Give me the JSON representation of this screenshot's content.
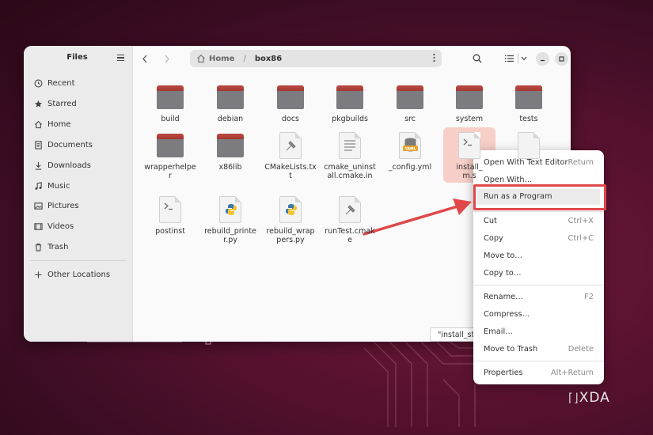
{
  "sidebar": {
    "title": "Files",
    "items": [
      {
        "label": "Recent",
        "icon": "clock-icon"
      },
      {
        "label": "Starred",
        "icon": "star-icon"
      },
      {
        "label": "Home",
        "icon": "home-icon"
      },
      {
        "label": "Documents",
        "icon": "document-icon"
      },
      {
        "label": "Downloads",
        "icon": "download-icon"
      },
      {
        "label": "Music",
        "icon": "music-icon"
      },
      {
        "label": "Pictures",
        "icon": "picture-icon"
      },
      {
        "label": "Videos",
        "icon": "video-icon"
      },
      {
        "label": "Trash",
        "icon": "trash-icon"
      }
    ],
    "other_locations": "Other Locations"
  },
  "path": {
    "home": "Home",
    "current": "box86"
  },
  "files": [
    {
      "label": "build",
      "type": "folder"
    },
    {
      "label": "debian",
      "type": "folder"
    },
    {
      "label": "docs",
      "type": "folder"
    },
    {
      "label": "pkgbuilds",
      "type": "folder"
    },
    {
      "label": "src",
      "type": "folder"
    },
    {
      "label": "system",
      "type": "folder"
    },
    {
      "label": "tests",
      "type": "folder"
    },
    {
      "label": "wrapperhelper",
      "type": "folder"
    },
    {
      "label": "x86lib",
      "type": "folder"
    },
    {
      "label": "CMakeLists.txt",
      "type": "cmake"
    },
    {
      "label": "cmake_uninstall.cmake.in",
      "type": "text"
    },
    {
      "label": "_config.yml",
      "type": "yaml"
    },
    {
      "label": "install_steam.sh",
      "type": "script"
    },
    {
      "label": "postinst",
      "type": "script"
    },
    {
      "label": "rebuild_printer.py",
      "type": "python"
    },
    {
      "label": "rebuild_wrappers.py",
      "type": "python"
    },
    {
      "label": "runTest.cmake",
      "type": "cmake"
    }
  ],
  "selected_label": "install_\nm.s",
  "tooltip": "\"install_steam.sh\"",
  "context_menu": [
    {
      "label": "Open With Text Editor",
      "shortcut": "Return"
    },
    {
      "label": "Open With…",
      "shortcut": ""
    },
    {
      "label": "Run as a Program",
      "shortcut": ""
    },
    {
      "label": "Cut",
      "shortcut": "Ctrl+X"
    },
    {
      "label": "Copy",
      "shortcut": "Ctrl+C"
    },
    {
      "label": "Move to…",
      "shortcut": ""
    },
    {
      "label": "Copy to…",
      "shortcut": ""
    },
    {
      "label": "Rename…",
      "shortcut": "F2"
    },
    {
      "label": "Compress…",
      "shortcut": ""
    },
    {
      "label": "Email…",
      "shortcut": ""
    },
    {
      "label": "Move to Trash",
      "shortcut": "Delete"
    },
    {
      "label": "Properties",
      "shortcut": "Alt+Return"
    }
  ],
  "watermark": "XDA",
  "colors": {
    "folder_tab": "#b4453d",
    "folder_body": "#7b7b80",
    "highlight": "#e0484a",
    "selection": "#f7cfc8"
  }
}
